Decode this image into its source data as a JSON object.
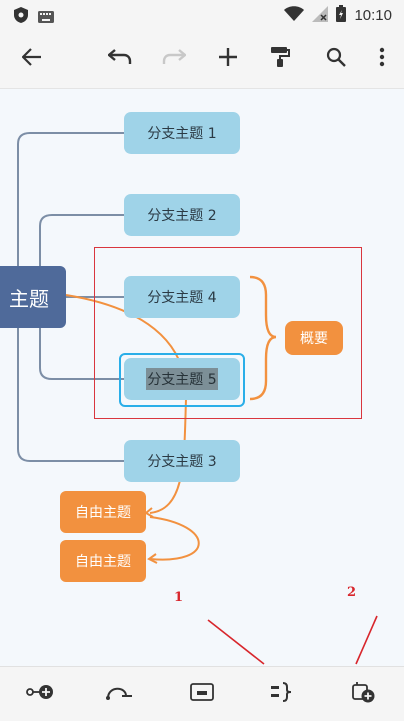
{
  "status_bar": {
    "time": "10:10"
  },
  "toolbar": {
    "buttons": [
      "back-icon",
      "undo-icon",
      "redo-icon",
      "add-icon",
      "format-painter-icon",
      "search-icon",
      "more-icon"
    ]
  },
  "mindmap": {
    "central_topic": "主题",
    "branches": [
      "分支主题 1",
      "分支主题 2",
      "分支主题 4",
      "分支主题 5",
      "分支主题 3"
    ],
    "summary": "概要",
    "free_topics": [
      "自由主题",
      "自由主题"
    ]
  },
  "annotations": {
    "label_1": "1",
    "label_2": "2"
  },
  "bottom_toolbar": {
    "buttons": [
      "relationship-icon",
      "boundary-icon",
      "callout-icon",
      "summary-icon",
      "floating-topic-icon"
    ]
  },
  "colors": {
    "branch_fill": "#9fd3e8",
    "central_fill": "#4f6a9a",
    "free_fill": "#f2913f",
    "connector_orange": "#f2913f",
    "selection_blue": "#2aaee8",
    "annotation_red": "#d8262c"
  }
}
